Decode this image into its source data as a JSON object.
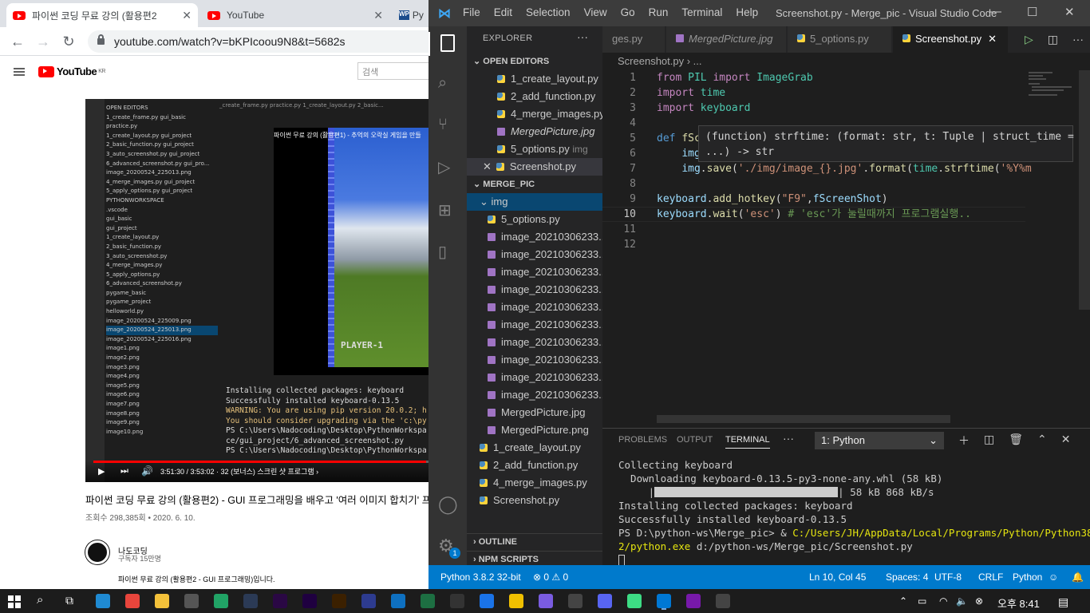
{
  "chrome": {
    "tabs": [
      {
        "label": "파이썬 코딩 무료 강의 (활용편2",
        "active": true
      },
      {
        "label": "YouTube",
        "active": false
      },
      {
        "label": "Py",
        "active": false
      }
    ],
    "url": "youtube.com/watch?v=bKPIcoou9N8&t=5682s",
    "brand": "YouTube",
    "brand_region": "KR",
    "search_placeholder": "검색",
    "video": {
      "caption": "파이썬 무료 강의 (활용편1) - 추억의 오락실 게임을 만들",
      "player1": "PLAYER-1",
      "inner_tree": [
        "OPEN EDITORS",
        "1_create_frame.py  gui_basic",
        "practice.py",
        "1_create_layout.py  gui_project",
        "2_basic_function.py  gui_project",
        "3_auto_screenshot.py  gui_project",
        "6_advanced_screenshot.py  gui_pro...",
        "image_20200524_225013.png",
        "4_merge_images.py  gui_project",
        "5_apply_options.py  gui_project",
        "PYTHONWORKSPACE",
        ".vscode",
        "gui_basic",
        "gui_project",
        "1_create_layout.py",
        "2_basic_function.py",
        "3_auto_screenshot.py",
        "4_merge_images.py",
        "5_apply_options.py",
        "6_advanced_screenshot.py",
        "pygame_basic",
        "pygame_project",
        "helloworld.py",
        "image_20200524_225009.png",
        "image_20200524_225013.png",
        "image_20200524_225016.png",
        "image1.png",
        "image2.png",
        "image3.png",
        "image4.png",
        "image5.png",
        "image6.png",
        "image7.png",
        "image8.png",
        "image9.png",
        "image10.png"
      ],
      "inner_tabs": "_create_frame.py    practice.py    1_create_layout.py    2_basic...",
      "inner_terminal": [
        "Installing collected packages: keyboard",
        "Successfully installed keyboard-0.13.5",
        "WARNING: You are using pip version 20.0.2; h",
        "You should consider upgrading via the 'c:\\py",
        "PS C:\\Users\\Nadocoding\\Desktop\\PythonWorkspa",
        "ce/gui_project/6_advanced_screenshot.py",
        "PS C:\\Users\\Nadocoding\\Desktop\\PythonWorkspa"
      ],
      "time": "3:51:30 / 3:53:02 · 32 (보너스) 스크린 샷 프로그램 ›",
      "progress": 0.993
    },
    "video_title": "파이썬 코딩 무료 강의 (활용편2) - GUI 프로그래밍을 배우고 '여러 이미지 합치기' 프",
    "video_meta": "조회수 298,385회 • 2020. 6. 10.",
    "channel": "나도코딩",
    "subscribers": "구독자 15만명",
    "description": "파이썬 무료 강의 (활용편2 - GUI 프로그래밍)입니다."
  },
  "vscode": {
    "menu": [
      "File",
      "Edit",
      "Selection",
      "View",
      "Go",
      "Run",
      "Terminal",
      "Help"
    ],
    "title": "Screenshot.py - Merge_pic - Visual Studio Code",
    "explorer_title": "EXPLORER",
    "open_editors_title": "OPEN EDITORS",
    "open_editors": [
      {
        "label": "1_create_layout.py",
        "type": "py",
        "desc": ""
      },
      {
        "label": "2_add_function.py",
        "type": "py",
        "desc": ""
      },
      {
        "label": "4_merge_images.py",
        "type": "py",
        "desc": ""
      },
      {
        "label": "MergedPicture.jpg",
        "type": "img",
        "desc": ""
      },
      {
        "label": "5_options.py",
        "type": "py",
        "desc": "img"
      },
      {
        "label": "Screenshot.py",
        "type": "py",
        "desc": ""
      }
    ],
    "folder_title": "MERGE_PIC",
    "img_folder": "img",
    "img_files": [
      {
        "label": "5_options.py",
        "type": "py"
      },
      {
        "label": "image_20210306233...",
        "type": "img"
      },
      {
        "label": "image_20210306233...",
        "type": "img"
      },
      {
        "label": "image_20210306233...",
        "type": "img"
      },
      {
        "label": "image_20210306233...",
        "type": "img"
      },
      {
        "label": "image_20210306233...",
        "type": "img"
      },
      {
        "label": "image_20210306233...",
        "type": "img"
      },
      {
        "label": "image_20210306233...",
        "type": "img"
      },
      {
        "label": "image_20210306233...",
        "type": "img"
      },
      {
        "label": "image_20210306233...",
        "type": "img"
      },
      {
        "label": "image_20210306233...",
        "type": "img"
      },
      {
        "label": "MergedPicture.jpg",
        "type": "img"
      },
      {
        "label": "MergedPicture.png",
        "type": "img"
      }
    ],
    "root_files": [
      "1_create_layout.py",
      "2_add_function.py",
      "4_merge_images.py",
      "Screenshot.py"
    ],
    "outline": "OUTLINE",
    "npm": "NPM SCRIPTS",
    "editor_tabs": [
      {
        "label": "ges.py",
        "italic": false
      },
      {
        "label": "MergedPicture.jpg",
        "italic": true
      },
      {
        "label": "5_options.py",
        "italic": false
      },
      {
        "label": "Screenshot.py",
        "italic": false
      }
    ],
    "breadcrumb": "Screenshot.py › ...",
    "code_lines": [
      "1",
      "2",
      "3",
      "4",
      "5",
      "6",
      "7",
      "8",
      "9",
      "10",
      "11",
      "12"
    ],
    "hover_line1": "(function) strftime: (format: str, t: Tuple | struct_time =",
    "hover_line2": "...) -> str",
    "panel_tabs": [
      "PROBLEMS",
      "OUTPUT",
      "TERMINAL"
    ],
    "panel_more": "···",
    "terminal_select": "1: Python",
    "terminal": {
      "l1": "Collecting keyboard",
      "l2": "  Downloading keyboard-0.13.5-py3-none-any.whl (58 kB)",
      "l3": " 58 kB 868 kB/s",
      "l4": "Installing collected packages: keyboard",
      "l5": "Successfully installed keyboard-0.13.5",
      "l6a": "PS D:\\python-ws\\Merge_pic> & ",
      "l6b": "C:/Users/JH/AppData/Local/Programs/Python/Python38-3",
      "l7a": "2/python.exe",
      "l7b": " d:/python-ws/Merge_pic/Screenshot.py"
    },
    "status": {
      "python": "Python 3.8.2 32-bit",
      "problems": "⊗ 0 ⚠ 0",
      "position": "Ln 10, Col 45",
      "spaces": "Spaces: 4",
      "encoding": "UTF-8",
      "eol": "CRLF",
      "language": "Python"
    },
    "accounts_badge": "1"
  },
  "taskbar": {
    "time": "오후 8:41",
    "apps": [
      "edge",
      "chrome",
      "explorer",
      "store",
      "excel-ish",
      "lightroom",
      "premiere",
      "after-effects",
      "bridge",
      "vscode-blue",
      "cube",
      "excel",
      "cmd",
      "maps",
      "notes",
      "vpn",
      "files",
      "discord",
      "android",
      "vscode",
      "onenote",
      "ms"
    ]
  },
  "colors": {
    "vscode_accent": "#007acc",
    "youtube_red": "#ff0000",
    "editor_bg": "#1e1e1e",
    "sidebar_bg": "#252526"
  }
}
